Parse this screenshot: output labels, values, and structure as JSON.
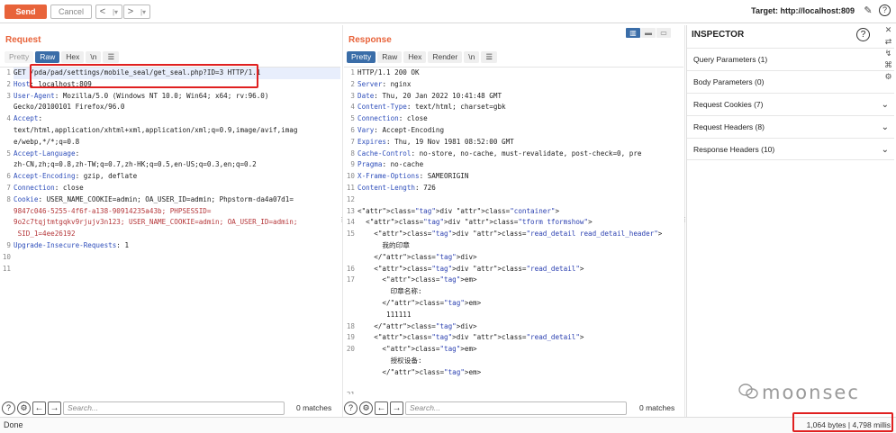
{
  "toolbar": {
    "send_label": "Send",
    "cancel_label": "Cancel",
    "back_symbol": "<",
    "back_menu": "|▾",
    "forward_symbol": ">",
    "forward_menu": "|▾",
    "target_label": "Target: http://localhost:809"
  },
  "request": {
    "title": "Request",
    "tabs": [
      "Pretty",
      "Raw",
      "Hex",
      "\\n"
    ],
    "active_tab": "Raw",
    "lines": [
      {
        "n": "1",
        "text": "GET /pda/pad/settings/mobile_seal/get_seal.php?ID=3 HTTP/1.1"
      },
      {
        "n": "2",
        "text": "Host: localhost:809"
      },
      {
        "n": "3",
        "text": "User-Agent: Mozilla/5.0 (Windows NT 10.0; Win64; x64; rv:96.0)"
      },
      {
        "n": "",
        "text": "Gecko/20100101 Firefox/96.0"
      },
      {
        "n": "4",
        "text": "Accept:"
      },
      {
        "n": "",
        "text": "text/html,application/xhtml+xml,application/xml;q=0.9,image/avif,imag"
      },
      {
        "n": "",
        "text": "e/webp,*/*;q=0.8"
      },
      {
        "n": "5",
        "text": "Accept-Language:"
      },
      {
        "n": "",
        "text": "zh-CN,zh;q=0.8,zh-TW;q=0.7,zh-HK;q=0.5,en-US;q=0.3,en;q=0.2"
      },
      {
        "n": "6",
        "text": "Accept-Encoding: gzip, deflate"
      },
      {
        "n": "7",
        "text": "Connection: close"
      },
      {
        "n": "8",
        "text": "Cookie: USER_NAME_COOKIE=admin; OA_USER_ID=admin; Phpstorm-da4a07d1="
      },
      {
        "n": "",
        "text": "9847c046-5255-4f6f-a138-90914235a43b; PHPSESSID="
      },
      {
        "n": "",
        "text": "9o2c7tqjtmtgqkv9rjujv3n123; USER_NAME_COOKIE=admin; OA_USER_ID=admin;"
      },
      {
        "n": "",
        "text": " SID_1=4ee26192"
      },
      {
        "n": "9",
        "text": "Upgrade-Insecure-Requests: 1"
      },
      {
        "n": "10",
        "text": ""
      },
      {
        "n": "11",
        "text": ""
      }
    ],
    "search_placeholder": "Search...",
    "matches": "0 matches"
  },
  "response": {
    "title": "Response",
    "tabs": [
      "Pretty",
      "Raw",
      "Hex",
      "Render",
      "\\n"
    ],
    "active_tab": "Pretty",
    "lines": [
      {
        "n": "1",
        "text": "HTTP/1.1 200 OK"
      },
      {
        "n": "2",
        "text": "Server: nginx"
      },
      {
        "n": "3",
        "text": "Date: Thu, 20 Jan 2022 10:41:48 GMT"
      },
      {
        "n": "4",
        "text": "Content-Type: text/html; charset=gbk"
      },
      {
        "n": "5",
        "text": "Connection: close"
      },
      {
        "n": "6",
        "text": "Vary: Accept-Encoding"
      },
      {
        "n": "7",
        "text": "Expires: Thu, 19 Nov 1981 08:52:00 GMT"
      },
      {
        "n": "8",
        "text": "Cache-Control: no-store, no-cache, must-revalidate, post-check=0, pre"
      },
      {
        "n": "9",
        "text": "Pragma: no-cache"
      },
      {
        "n": "10",
        "text": "X-Frame-Options: SAMEORIGIN"
      },
      {
        "n": "11",
        "text": "Content-Length: 726"
      },
      {
        "n": "12",
        "text": ""
      },
      {
        "n": "13",
        "text": "<div class=\"container\">"
      },
      {
        "n": "14",
        "text": "  <div class=\"tform tformshow\">"
      },
      {
        "n": "15",
        "text": "    <div class=\"read_detail read_detail_header\">"
      },
      {
        "n": "",
        "text": "      我的印章"
      },
      {
        "n": "",
        "text": "    </div>"
      },
      {
        "n": "16",
        "text": "    <div class=\"read_detail\">"
      },
      {
        "n": "17",
        "text": "      <em>"
      },
      {
        "n": "",
        "text": "        印章名称:"
      },
      {
        "n": "",
        "text": "      </em>"
      },
      {
        "n": "",
        "text": "       111111"
      },
      {
        "n": "18",
        "text": "    </div>"
      },
      {
        "n": "19",
        "text": "    <div class=\"read_detail\">"
      },
      {
        "n": "20",
        "text": "      <em>"
      },
      {
        "n": "",
        "text": "        授权设备:"
      },
      {
        "n": "",
        "text": "      </em>"
      },
      {
        "n": "",
        "text": ""
      },
      {
        "n": "21",
        "text": ""
      }
    ],
    "search_placeholder": "Search...",
    "matches": "0 matches"
  },
  "inspector": {
    "title": "INSPECTOR",
    "rows": [
      "Query Parameters (1)",
      "Body Parameters (0)",
      "Request Cookies (7)",
      "Request Headers (8)",
      "Response Headers (10)"
    ]
  },
  "status": {
    "left": "Done",
    "right": "1,064 bytes | 4,798 millis"
  },
  "watermark": "moonsec",
  "colors": {
    "accent": "#e8633a",
    "tab_active": "#3a6da8",
    "highlight_box": "#e02020"
  }
}
